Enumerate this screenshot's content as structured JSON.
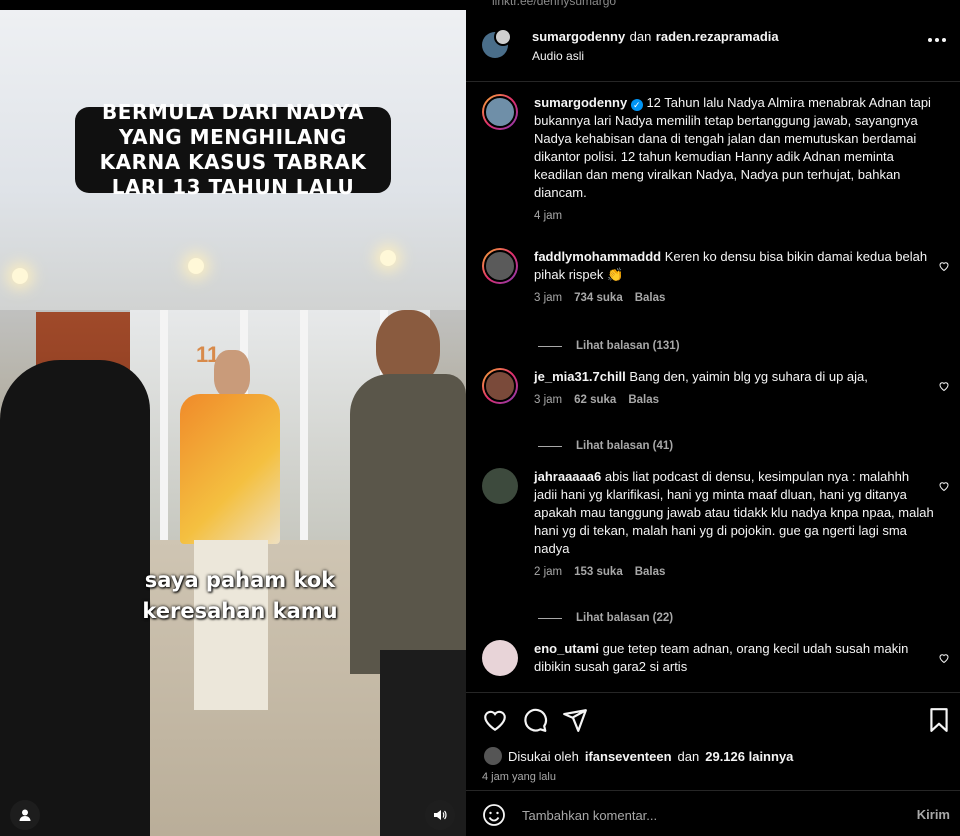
{
  "top_url": "linktr.ee/dennysumargo",
  "video": {
    "caption_box": "BERMULA DARI NADYA YANG MENGHILANG KARNA KASUS TABRAK LARI 13 TAHUN LALU",
    "subtitle_line1": "saya paham kok",
    "subtitle_line2": "keresahan kamu",
    "sign_number": "11",
    "user_icon": "user-icon",
    "volume_icon": "volume-icon"
  },
  "header": {
    "user1": "sumargodenny",
    "connector": "dan",
    "user2": "raden.rezapramadia",
    "audio": "Audio asli",
    "more_icon": "more-icon"
  },
  "caption": {
    "user": "sumargodenny",
    "text": "12 Tahun lalu Nadya Almira menabrak Adnan tapi bukannya lari Nadya memilih tetap bertanggung jawab, sayangnya Nadya kehabisan dana di tengah jalan dan memutuskan berdamai dikantor polisi. 12 tahun kemudian Hanny adik Adnan meminta keadilan dan meng viralkan Nadya, Nadya pun terhujat, bahkan diancam.",
    "time": "4 jam"
  },
  "comments": [
    {
      "user": "faddlymohammaddd",
      "text": "Keren ko densu bisa bikin damai kedua belah pihak rispek 👏",
      "time": "3 jam",
      "likes": "734 suka",
      "reply": "Balas",
      "view_replies": "Lihat balasan (131)"
    },
    {
      "user": "je_mia31.7chill",
      "text": "Bang den, yaimin blg yg suhara di up aja,",
      "time": "3 jam",
      "likes": "62 suka",
      "reply": "Balas",
      "view_replies": "Lihat balasan (41)"
    },
    {
      "user": "jahraaaaa6",
      "text": "abis liat podcast di densu, kesimpulan nya : malahhh jadii hani yg klarifikasi, hani yg minta maaf dluan, hani yg ditanya apakah mau tanggung jawab atau tidakk klu nadya knpa npaa, malah hani yg di tekan, malah hani yg di pojokin. gue ga ngerti lagi sma nadya",
      "time": "2 jam",
      "likes": "153 suka",
      "reply": "Balas",
      "view_replies": "Lihat balasan (22)"
    },
    {
      "user": "eno_utami",
      "text": "gue tetep team adnan, orang kecil udah susah makin dibikin susah gara2 si artis"
    }
  ],
  "actions": {
    "liked_prefix": "Disukai oleh",
    "liked_user": "ifanseventeen",
    "liked_and": "dan",
    "liked_count": "29.126 lainnya",
    "posted": "4 jam yang lalu"
  },
  "add_comment": {
    "placeholder": "Tambahkan komentar...",
    "send": "Kirim"
  },
  "colors": {
    "background": "#000000",
    "text": "#f5f5f5",
    "muted": "#a8a8a8",
    "verified": "#0095f6"
  }
}
